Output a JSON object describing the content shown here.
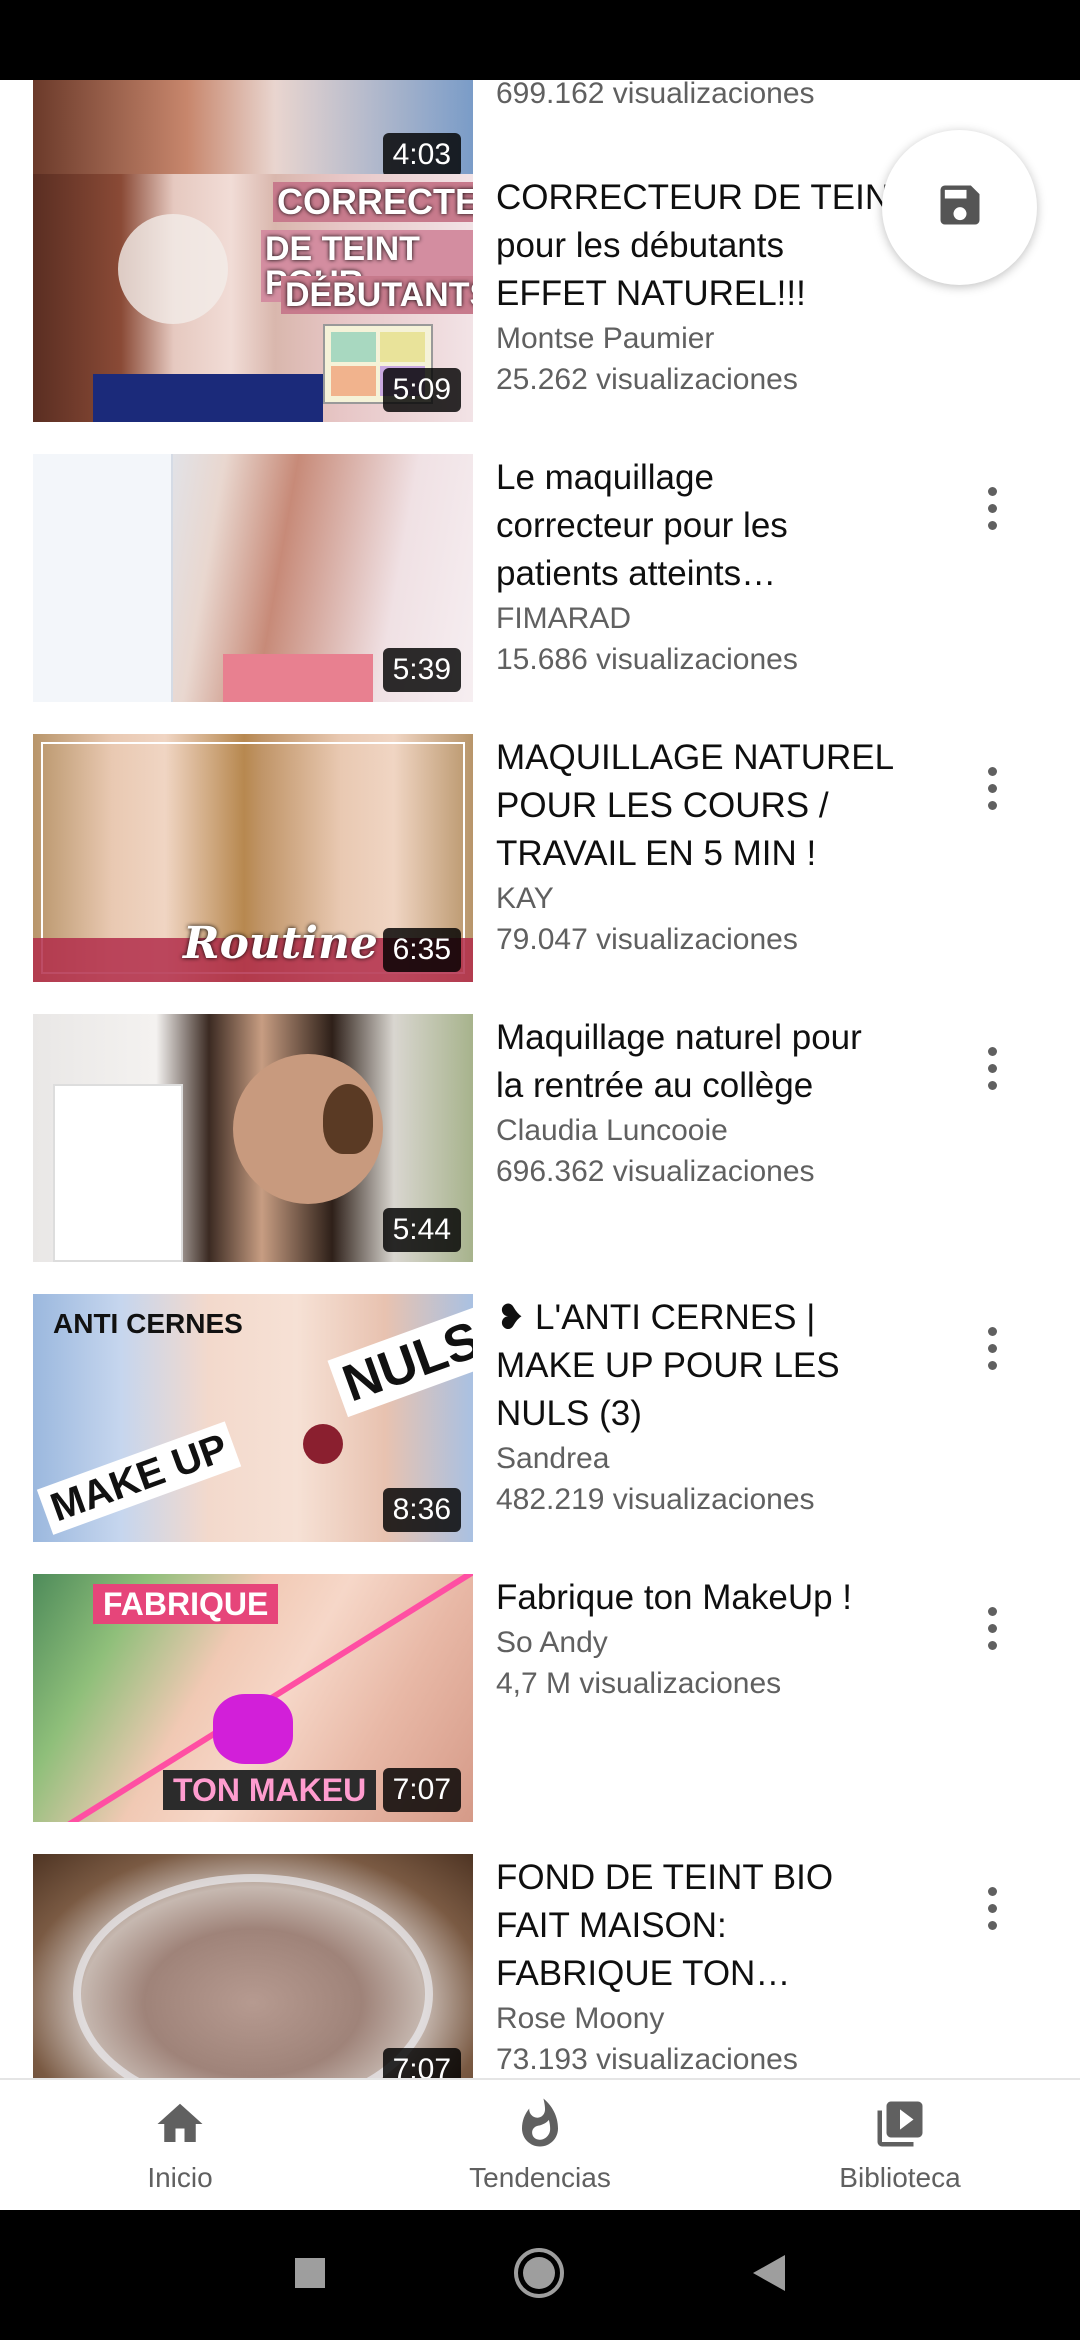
{
  "videos": [
    {
      "title": "",
      "channel": "",
      "views": "699.162 visualizaciones",
      "duration": "4:03"
    },
    {
      "title": "CORRECTEUR DE TEINT pour les débutants EFFET NATUREL!!!",
      "title_lines": [
        "CORRECTEUR DE TEINT",
        "pour les débutants",
        "EFFET NATUREL!!!"
      ],
      "channel": "Montse Paumier",
      "views": "25.262 visualizaciones",
      "duration": "5:09",
      "thumb_text": [
        "CORRECTEUR",
        "DE TEINT POUR",
        "DÉBUTANTS"
      ]
    },
    {
      "title_lines": [
        "Le maquillage",
        "correcteur pour les",
        "patients atteints…"
      ],
      "channel": "FIMARAD",
      "views": "15.686 visualizaciones",
      "duration": "5:39"
    },
    {
      "title_lines": [
        "MAQUILLAGE NATUREL",
        "POUR LES COURS /",
        "TRAVAIL EN 5 MIN !"
      ],
      "channel": "KAY",
      "views": "79.047 visualizaciones",
      "duration": "6:35",
      "thumb_text": [
        "Routine"
      ]
    },
    {
      "title_lines": [
        "Maquillage naturel pour",
        "la rentrée au collège"
      ],
      "channel": "Claudia Luncooie",
      "views": "696.362 visualizaciones",
      "duration": "5:44"
    },
    {
      "title_lines": [
        "❥ L'ANTI CERNES |",
        "MAKE UP POUR LES",
        "NULS (3)"
      ],
      "channel": "Sandrea",
      "views": "482.219 visualizaciones",
      "duration": "8:36",
      "thumb_text": [
        "ANTI CERNES",
        "MAKE UP",
        "NULS"
      ]
    },
    {
      "title_lines": [
        "Fabrique ton MakeUp !"
      ],
      "channel": "So Andy",
      "views": "4,7 M visualizaciones",
      "duration": "7:07",
      "thumb_text": [
        "FABRIQUE",
        "TON MAKEU"
      ]
    },
    {
      "title_lines": [
        "FOND DE TEINT BIO",
        "FAIT MAISON:",
        "FABRIQUE TON…"
      ],
      "channel": "Rose Moony",
      "views": "73.193 visualizaciones",
      "duration": "7:07"
    }
  ],
  "bottom_nav": {
    "home": "Inicio",
    "trending": "Tendencias",
    "library": "Biblioteca"
  },
  "colors": {
    "text_primary": "#0f0f0f",
    "text_secondary": "#606060",
    "duration_bg": "#000000"
  },
  "icons": {
    "fab": "save-icon",
    "home": "home-icon",
    "trending": "flame-icon",
    "library": "library-icon"
  }
}
